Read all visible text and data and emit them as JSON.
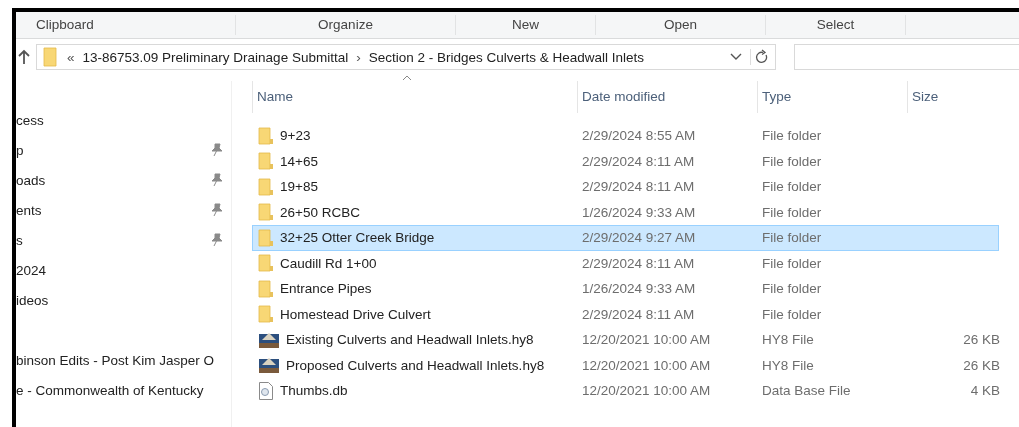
{
  "ribbon": {
    "groups": [
      "Clipboard",
      "Organize",
      "New",
      "Open",
      "Select"
    ]
  },
  "address_bar": {
    "overflow": "«",
    "crumbs": [
      "13-86753.09 Preliminary Drainage Submittal",
      "Section 2 - Bridges Culverts & Headwall Inlets"
    ],
    "separator": "›"
  },
  "nav_pane": {
    "items": [
      {
        "label": "cess",
        "pinned": false,
        "gap_before": false
      },
      {
        "label": "p",
        "pinned": true,
        "gap_before": false
      },
      {
        "label": "oads",
        "pinned": true,
        "gap_before": false
      },
      {
        "label": "ents",
        "pinned": true,
        "gap_before": false
      },
      {
        "label": "s",
        "pinned": true,
        "gap_before": false
      },
      {
        "label": "2024",
        "pinned": false,
        "gap_before": false
      },
      {
        "label": "ideos",
        "pinned": false,
        "gap_before": false
      },
      {
        "label": "binson Edits - Post Kim Jasper O",
        "pinned": false,
        "gap_before": true
      },
      {
        "label": "e - Commonwealth of Kentucky",
        "pinned": false,
        "gap_before": false
      }
    ]
  },
  "file_list": {
    "columns": [
      "Name",
      "Date modified",
      "Type",
      "Size"
    ],
    "rows": [
      {
        "kind": "folder",
        "name": "9+23",
        "date": "2/29/2024 8:55 AM",
        "type": "File folder",
        "selected": false
      },
      {
        "kind": "folder",
        "name": "14+65",
        "date": "2/29/2024 8:11 AM",
        "type": "File folder",
        "selected": false
      },
      {
        "kind": "folder",
        "name": "19+85",
        "date": "2/29/2024 8:11 AM",
        "type": "File folder",
        "selected": false
      },
      {
        "kind": "folder",
        "name": "26+50 RCBC",
        "date": "1/26/2024 9:33 AM",
        "type": "File folder",
        "selected": false
      },
      {
        "kind": "folder",
        "name": "32+25 Otter Creek Bridge",
        "date": "2/29/2024 9:27 AM",
        "type": "File folder",
        "selected": true
      },
      {
        "kind": "folder",
        "name": "Caudill Rd 1+00",
        "date": "2/29/2024 8:11 AM",
        "type": "File folder",
        "selected": false
      },
      {
        "kind": "folder",
        "name": "Entrance Pipes",
        "date": "1/26/2024 9:33 AM",
        "type": "File folder",
        "selected": false
      },
      {
        "kind": "folder",
        "name": "Homestead Drive Culvert",
        "date": "2/29/2024 8:11 AM",
        "type": "File folder",
        "selected": false
      },
      {
        "kind": "hy8",
        "name": "Existing Culverts and Headwall Inlets.hy8",
        "date": "12/20/2021 10:00 AM",
        "type": "HY8 File",
        "size": "26 KB",
        "selected": false
      },
      {
        "kind": "hy8",
        "name": "Proposed Culverts and Headwall Inlets.hy8",
        "date": "12/20/2021 10:00 AM",
        "type": "HY8 File",
        "size": "26 KB",
        "selected": false
      },
      {
        "kind": "db",
        "name": "Thumbs.db",
        "date": "12/20/2021 10:00 AM",
        "type": "Data Base File",
        "size": "4 KB",
        "selected": false
      }
    ]
  }
}
